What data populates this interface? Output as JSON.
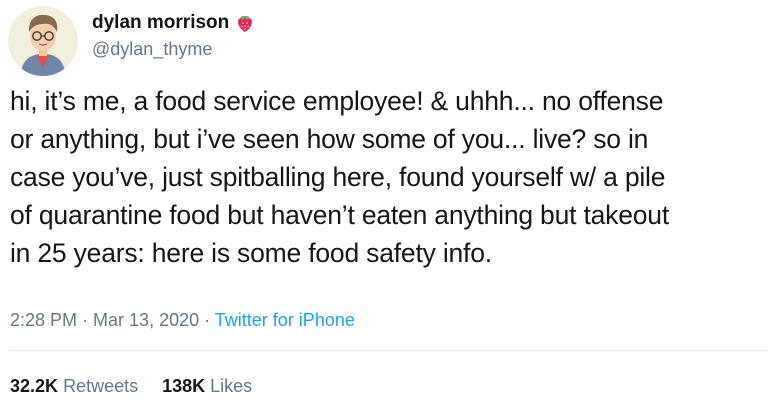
{
  "author": {
    "display_name": "dylan morrison",
    "handle": "@dylan_thyme",
    "avatar_icon": "cartoon-avatar",
    "name_emoji_icon": "strawberry-icon"
  },
  "tweet": {
    "lines": [
      "hi, it’s me, a food service employee! & uhhh... no offense",
      "or anything, but i’ve seen how some of you... live? so in",
      "case you’ve, just spitballing here, found yourself w/ a pile",
      "of quarantine food but haven’t eaten anything but takeout",
      "in 25 years: here is some food safety info."
    ]
  },
  "meta": {
    "time": "2:28 PM",
    "separator": " · ",
    "date": "Mar 13, 2020",
    "source": "Twitter for iPhone"
  },
  "stats": {
    "retweets_count": "32.2K",
    "retweets_label": "Retweets",
    "likes_count": "138K",
    "likes_label": "Likes"
  },
  "colors": {
    "text": "#14171a",
    "secondary": "#657786",
    "link": "#1da1f2",
    "divider": "#e6ecf0"
  }
}
